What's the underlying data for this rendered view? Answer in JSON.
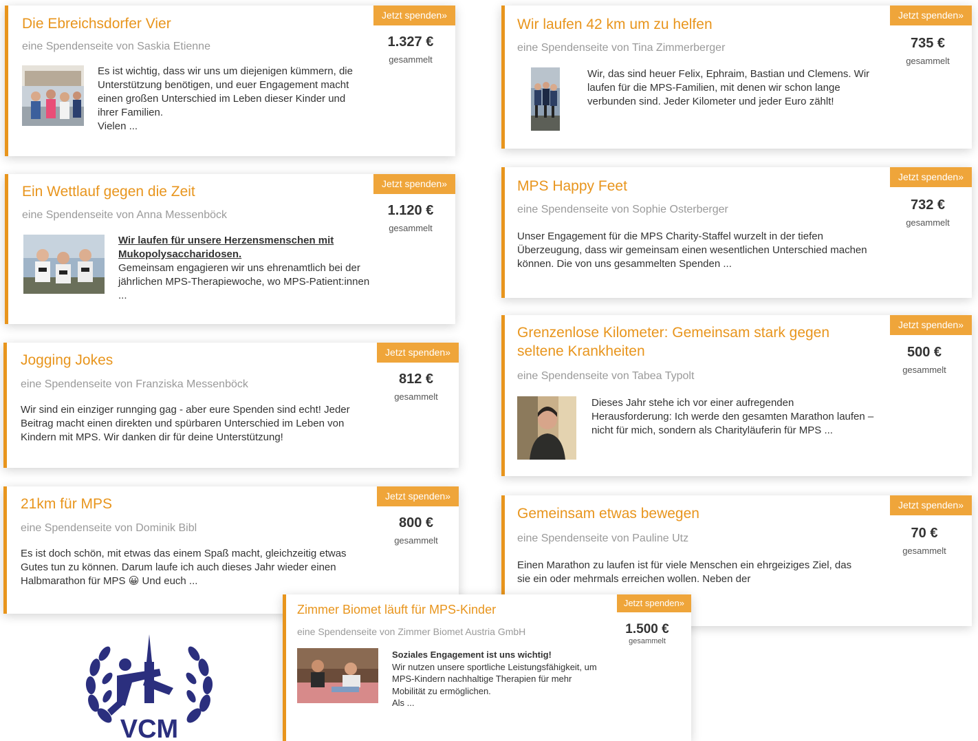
{
  "donate_label": "Jetzt spenden»",
  "collected_label": "gesammelt",
  "cards": [
    {
      "title": "Die Ebreichsdorfer Vier",
      "subtitle": "eine Spendenseite von Saskia Etienne",
      "amount": "1.327 €",
      "description": "Es ist wichtig, dass wir uns um diejenigen kümmern, die Unterstützung benötigen, und euer Engagement macht einen großen Unterschied im Leben dieser Kinder und ihrer Familien.\nVielen ...",
      "image": "group-photo"
    },
    {
      "title": "Ein Wettlauf gegen die Zeit",
      "subtitle": "eine Spendenseite von Anna Messenböck",
      "amount": "1.120 €",
      "headline": "Wir laufen für unsere Herzensmenschen mit Mukopolysaccharidosen.",
      "description": "Gemeinsam engagieren wir uns ehrenamtlich bei der jährlichen MPS-Therapiewoche, wo MPS-Patient:innen ...",
      "image": "runners-photo"
    },
    {
      "title": "Jogging Jokes",
      "subtitle": "eine Spendenseite von Franziska Messenböck",
      "amount": "812 €",
      "description": "Wir sind ein einziger runnging gag - aber eure Spenden sind echt! Jeder Beitrag macht einen direkten und spürbaren Unterschied im Leben von Kindern mit MPS. Wir danken dir für deine Unterstützung!"
    },
    {
      "title": "21km für MPS",
      "subtitle": "eine Spendenseite von Dominik Bibl",
      "amount": "800 €",
      "description": "Es ist doch schön, mit etwas das einem Spaß macht, gleichzeitig etwas Gutes tun zu können. Darum laufe ich auch dieses Jahr wieder einen Halbmarathon für MPS 😀 Und euch ..."
    },
    {
      "title": "Wir laufen 42 km um zu helfen",
      "subtitle": "eine Spendenseite von Tina Zimmerberger",
      "amount": "735 €",
      "description": "Wir, das sind heuer Felix, Ephraim, Bastian und Clemens. Wir laufen für die MPS-Familien, mit denen wir schon lange verbunden sind. Jeder Kilometer und jeder Euro zählt!",
      "image": "team-photo"
    },
    {
      "title": "MPS Happy Feet",
      "subtitle": "eine Spendenseite von Sophie Osterberger",
      "amount": "732 €",
      "description": "Unser Engagement für die MPS Charity-Staffel wurzelt in der tiefen Überzeugung, dass wir gemeinsam einen wesentlichen Unterschied machen können. Die von uns gesammelten Spenden ..."
    },
    {
      "title": "Grenzenlose Kilometer: Gemeinsam stark gegen seltene Krankheiten",
      "subtitle": "eine Spendenseite von Tabea Typolt",
      "amount": "500 €",
      "description": "Dieses Jahr stehe ich vor einer aufregenden Herausforderung: Ich werde den gesamten Marathon laufen – nicht für mich, sondern als Charityläuferin für MPS ...",
      "image": "portrait-photo"
    },
    {
      "title": "Gemeinsam etwas bewegen",
      "subtitle": "eine Spendenseite von Pauline Utz",
      "amount": "70 €",
      "description": "Einen Marathon zu laufen ist für viele Menschen ein ehrgeiziges Ziel, das sie ein oder mehrmals erreichen wollen. Neben der"
    },
    {
      "title": "Zimmer Biomet läuft für MPS-Kinder",
      "subtitle": "eine Spendenseite von Zimmer Biomet Austria GmbH",
      "amount": "1.500 €",
      "headline": "Soziales Engagement ist uns wichtig!",
      "description": "Wir nutzen unsere sportliche Leistungsfähigkeit, um MPS-Kindern nachhaltige Therapien für mehr Mobilität zu ermöglichen.\nAls ...",
      "image": "therapy-photo"
    }
  ],
  "logo": {
    "text": "VCM",
    "color": "#2b2f7e"
  }
}
